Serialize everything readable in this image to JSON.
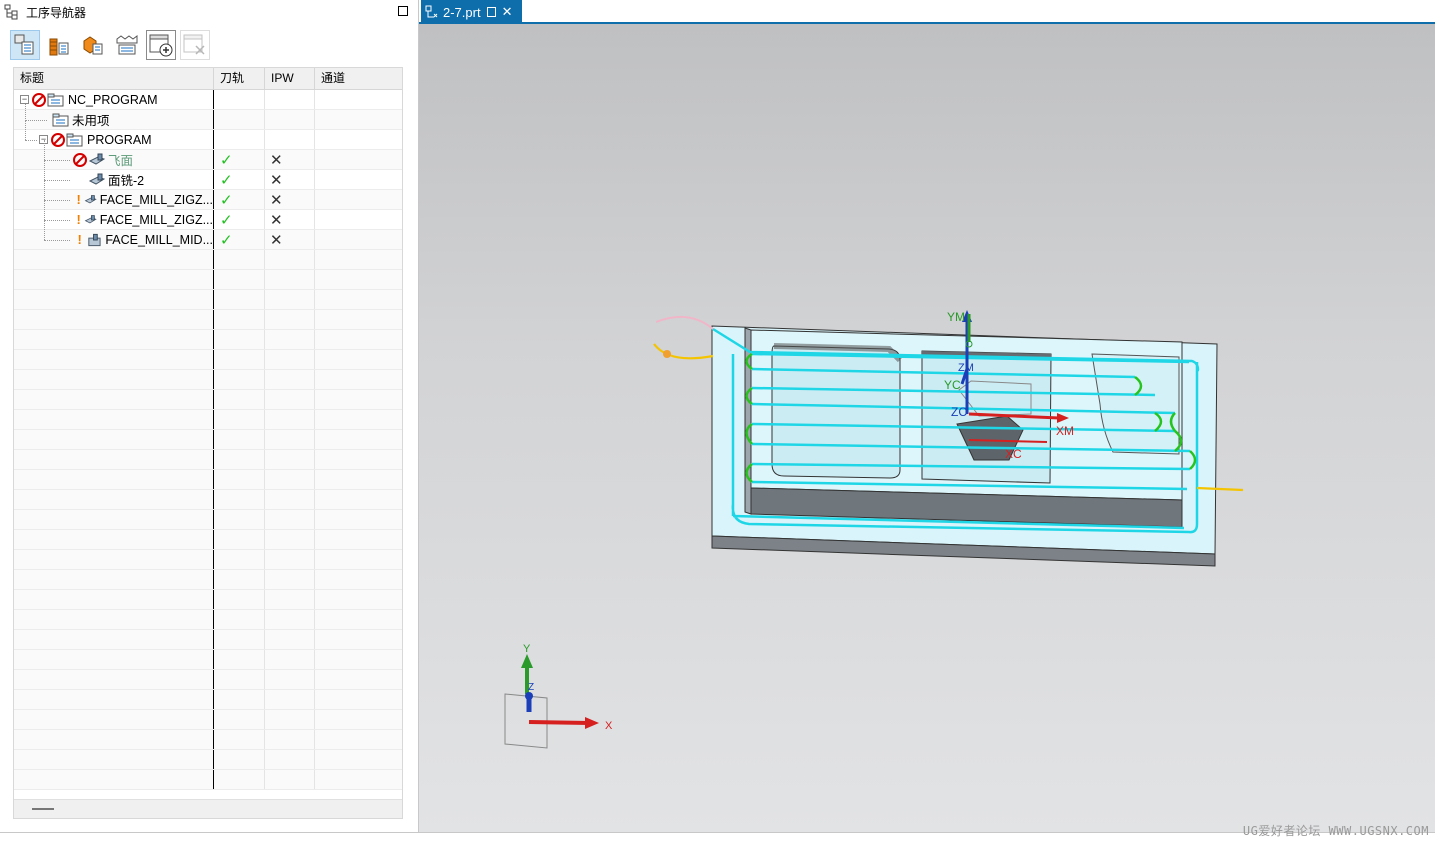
{
  "navigator": {
    "title": "工序导航器",
    "columns": [
      "标题",
      "刀轨",
      "IPW",
      "通道"
    ],
    "rows": [
      {
        "name": "NC_PROGRAM",
        "status": "no",
        "toolpath": "",
        "ipw": ""
      },
      {
        "name": "未用项",
        "status": "",
        "toolpath": "",
        "ipw": ""
      },
      {
        "name": "PROGRAM",
        "status": "no",
        "toolpath": "",
        "ipw": ""
      },
      {
        "name": "飞面",
        "status": "no",
        "toolpath": "✓",
        "ipw": "✕"
      },
      {
        "name": "面铣-2",
        "status": "",
        "toolpath": "✓",
        "ipw": "✕"
      },
      {
        "name": "FACE_MILL_ZIGZ...",
        "status": "warn",
        "toolpath": "✓",
        "ipw": "✕"
      },
      {
        "name": "FACE_MILL_ZIGZ...",
        "status": "warn",
        "toolpath": "✓",
        "ipw": "✕"
      },
      {
        "name": "FACE_MILL_MID...",
        "status": "warn",
        "toolpath": "✓",
        "ipw": "✕"
      }
    ],
    "toolbar_icons": [
      "program-order-view-icon",
      "machine-tool-view-icon",
      "geometry-view-icon",
      "method-view-icon",
      "create-operation-icon",
      "delete-icon"
    ]
  },
  "tab": {
    "label": "2-7.prt",
    "close": "✕"
  },
  "viewport": {
    "axis_labels": {
      "ym": "YM",
      "yc": "YC",
      "zm": "ZM",
      "zc": "ZC",
      "xm": "XM",
      "xc": "XC",
      "triad_x": "X",
      "triad_y": "Y",
      "triad_z": "Z"
    },
    "colors": {
      "toolpath": "#1fd6e6",
      "engage": "#27c41d",
      "approach": "#f5c400",
      "retract": "#f0b6c8",
      "x_axis": "#d62020",
      "y_axis": "#2a9a2a",
      "z_axis": "#1a3fb8"
    }
  },
  "watermark": "UG爱好者论坛 WWW.UGSNX.COM"
}
